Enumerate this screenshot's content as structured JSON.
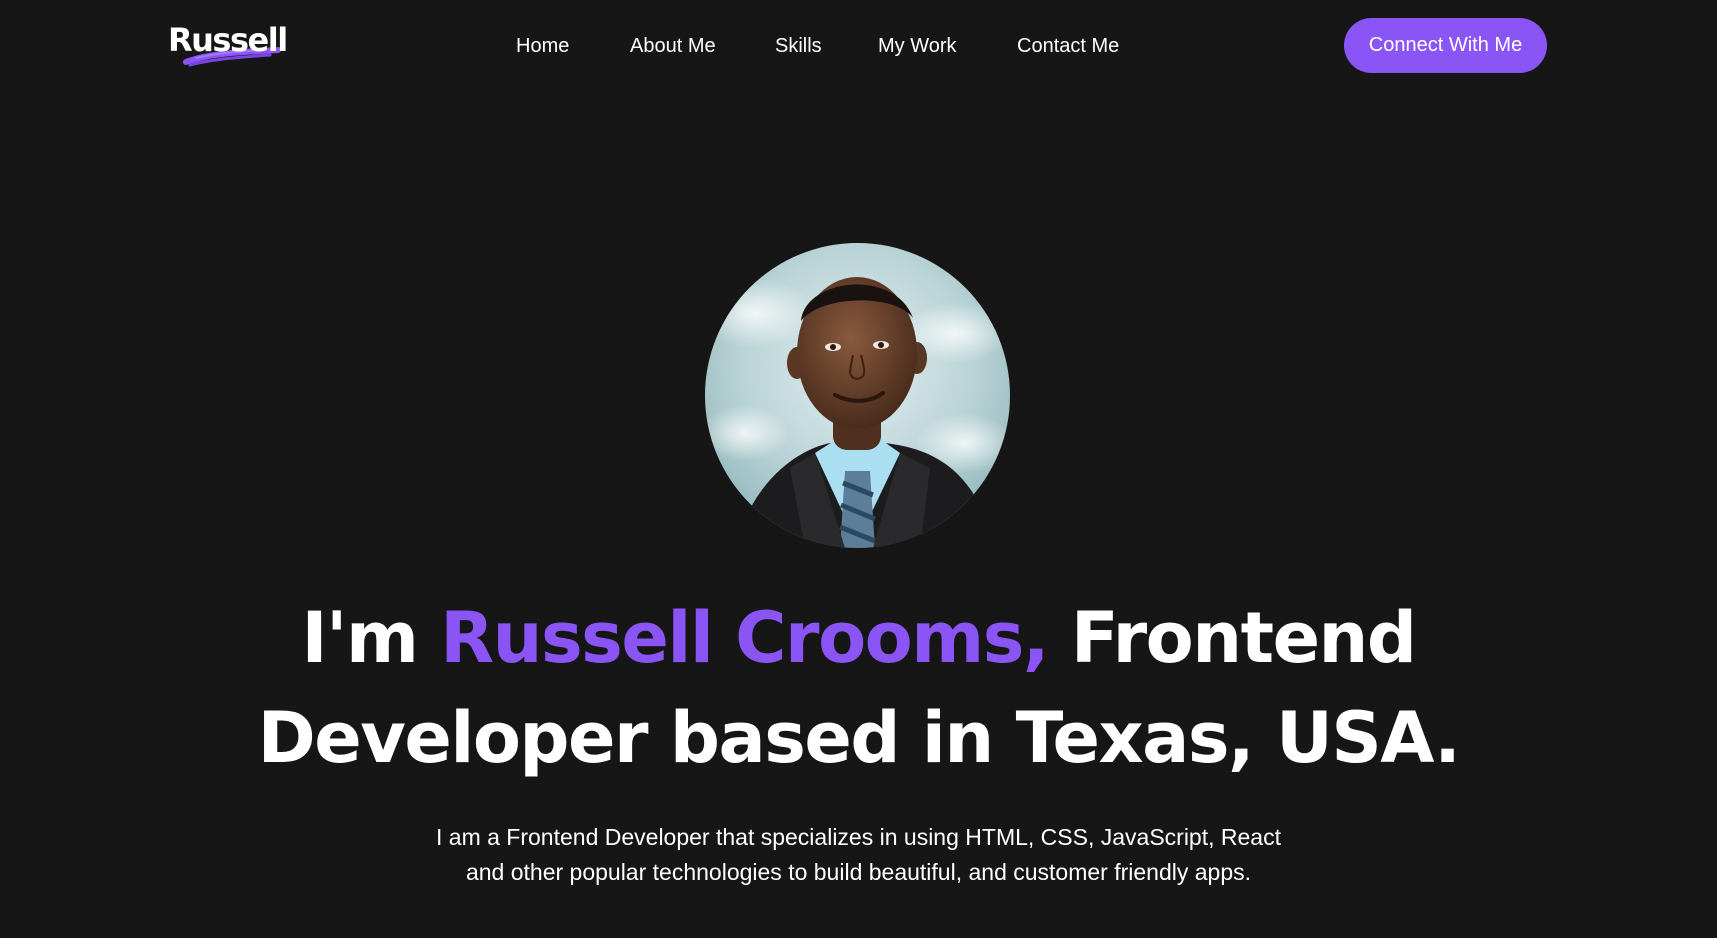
{
  "header": {
    "logo_text": "Russell",
    "nav": {
      "home": "Home",
      "about": "About Me",
      "skills": "Skills",
      "work": "My Work",
      "contact": "Contact Me"
    },
    "cta_label": "Connect With Me"
  },
  "hero": {
    "avatar_icon": "portrait-photo",
    "headline": {
      "prefix": "I'm ",
      "name": "Russell Crooms,",
      "suffix": " Frontend Developer based in Texas, USA."
    },
    "intro": "I am a Frontend Developer that specializes in using HTML, CSS, JavaScript, React and other popular technologies to build beautiful, and customer friendly apps."
  },
  "colors": {
    "background": "#161616",
    "accent": "#8b55f6",
    "text": "#ffffff"
  }
}
